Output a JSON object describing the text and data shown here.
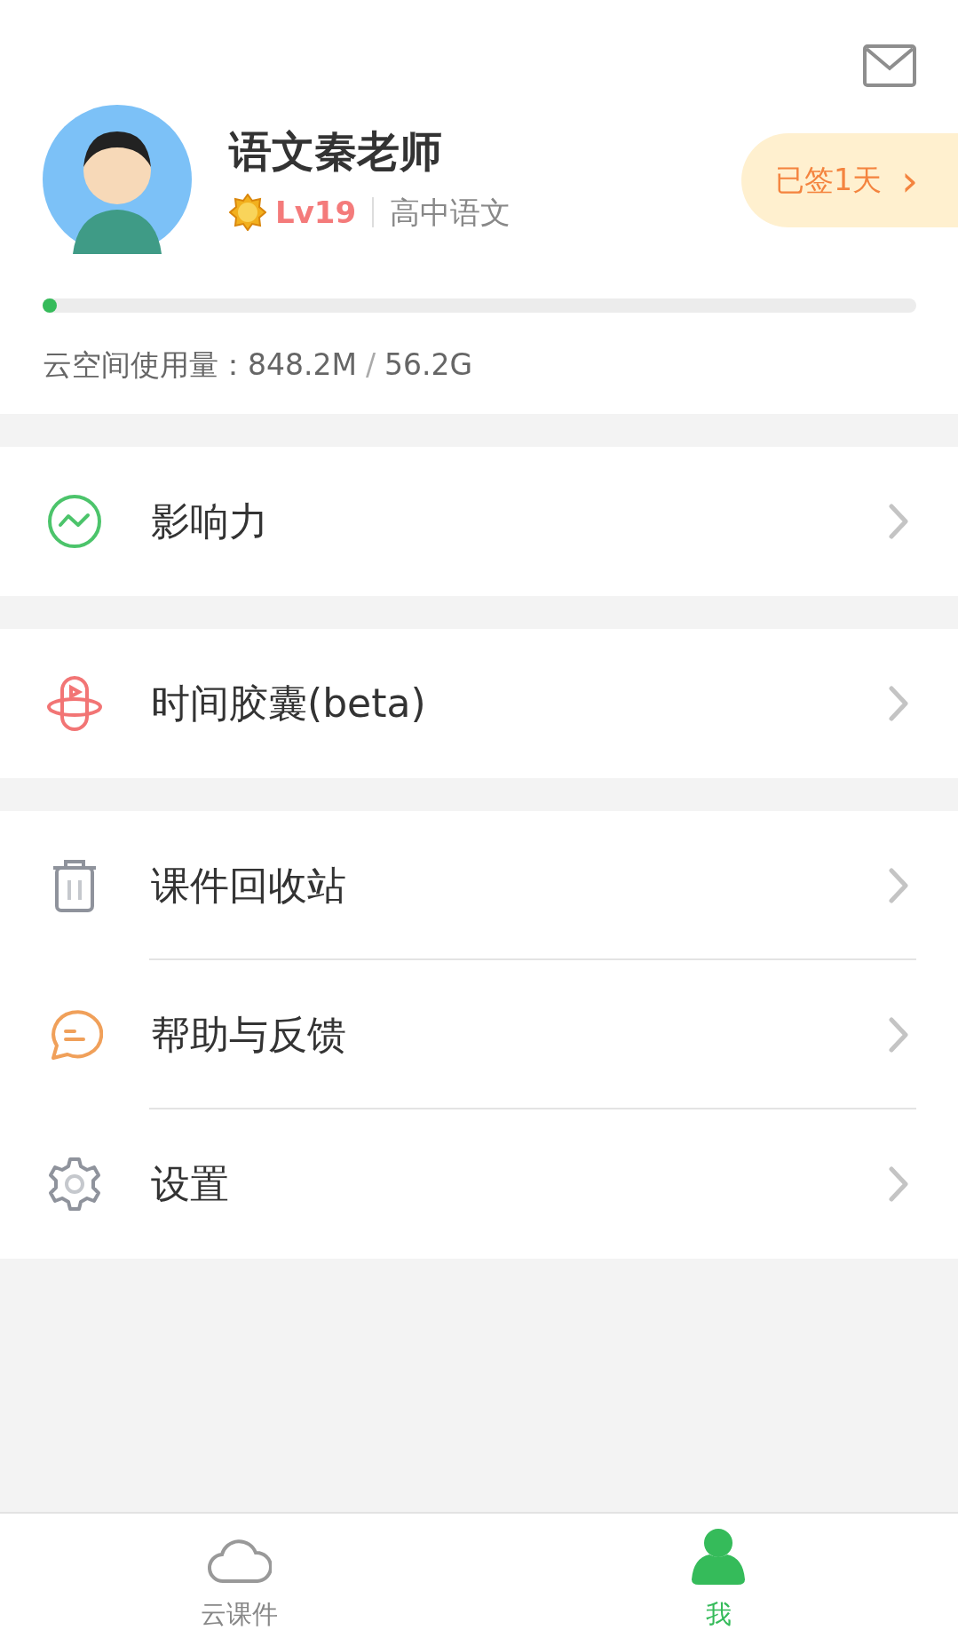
{
  "profile": {
    "name": "语文秦老师",
    "level_badge": "Lv19",
    "subject": "高中语文",
    "checkin": "已签1天",
    "checkin_arrow": "›"
  },
  "storage": {
    "level": 0.016,
    "label": "云空间使用量：",
    "used": "848.2M",
    "separator": "/",
    "total": "56.2G"
  },
  "menu_groups": [
    [
      {
        "kind": "influence",
        "label": "影响力"
      }
    ],
    [
      {
        "kind": "capsule",
        "label": "时间胶囊(beta)"
      }
    ],
    [
      {
        "kind": "trash",
        "label": "课件回收站"
      },
      {
        "kind": "feedback",
        "label": "帮助与反馈"
      },
      {
        "kind": "settings",
        "label": "设置"
      }
    ]
  ],
  "tabs": [
    {
      "kind": "cloud",
      "label": "云课件",
      "selected": false
    },
    {
      "kind": "me",
      "label": "我",
      "selected": true
    }
  ]
}
